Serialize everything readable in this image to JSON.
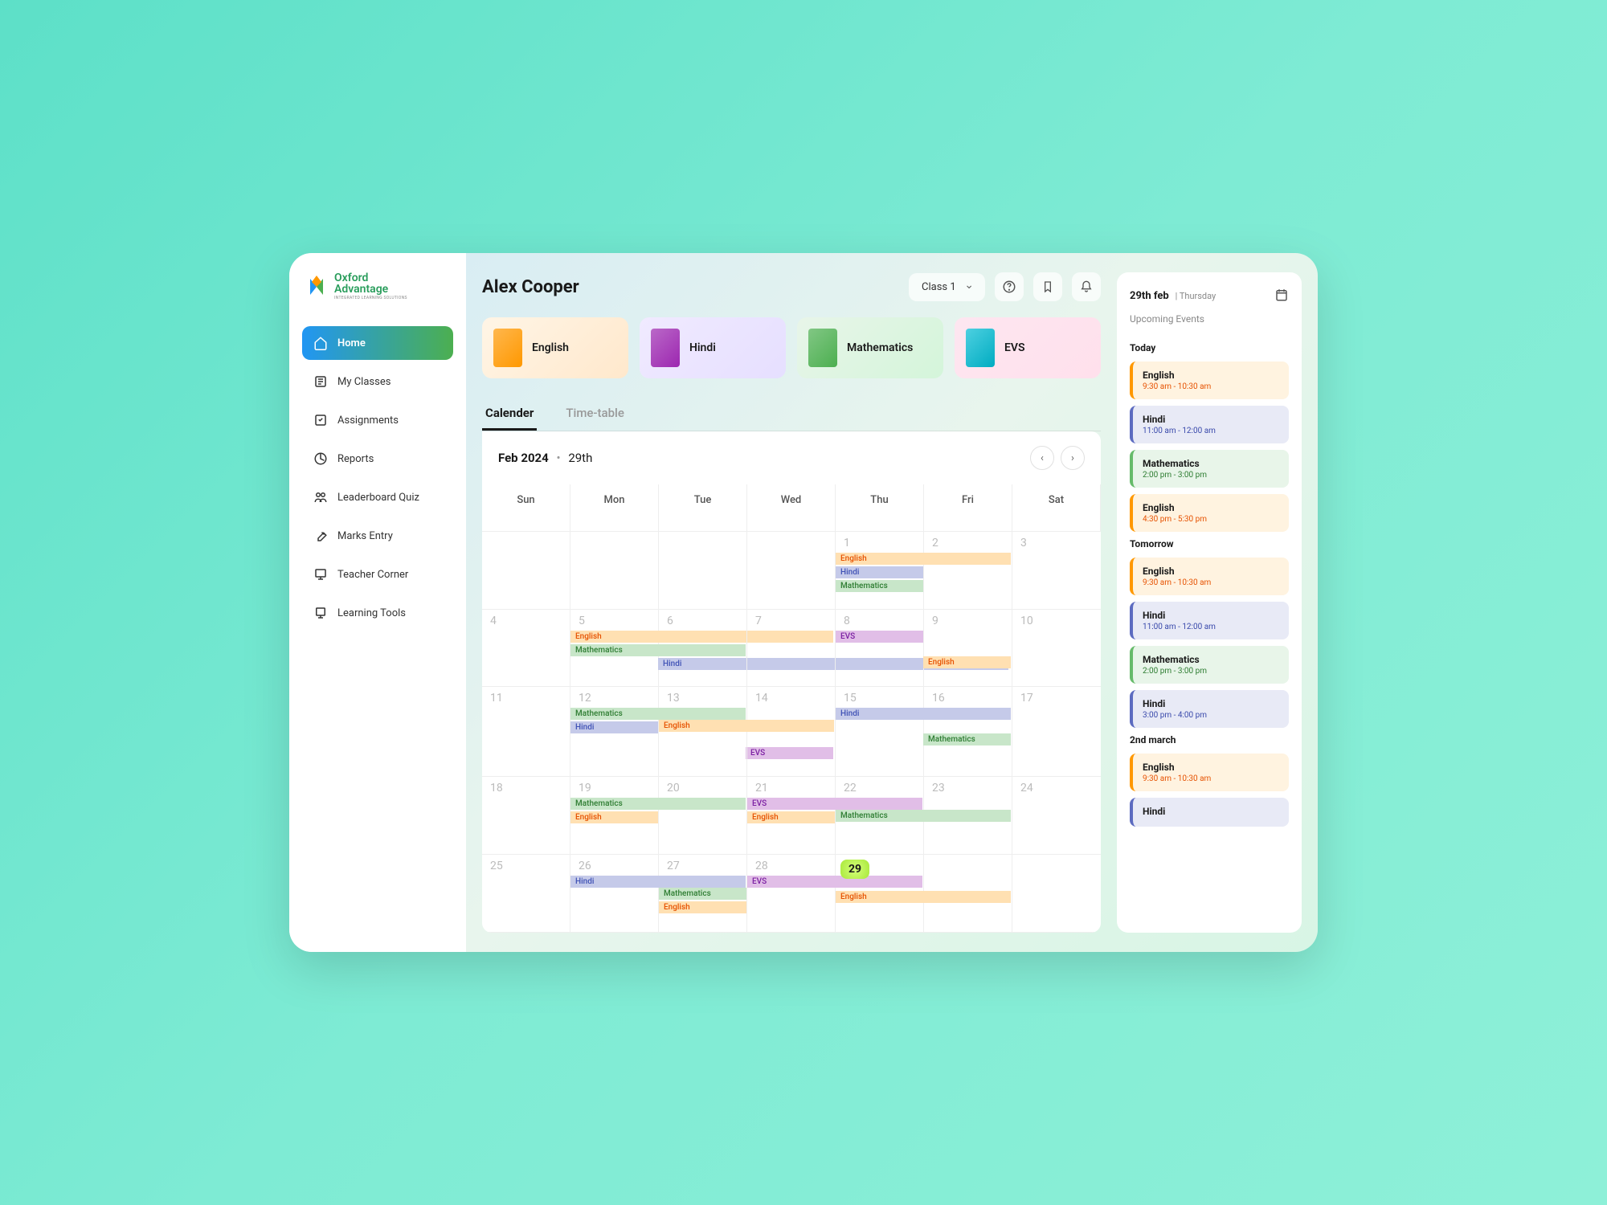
{
  "brand": {
    "line1": "Oxford",
    "line2": "Advantage",
    "tagline": "INTEGRATED LEARNING SOLUTIONS"
  },
  "nav": [
    {
      "label": "Home",
      "icon": "home",
      "active": true
    },
    {
      "label": "My Classes",
      "icon": "classes",
      "active": false
    },
    {
      "label": "Assignments",
      "icon": "assignments",
      "active": false
    },
    {
      "label": "Reports",
      "icon": "reports",
      "active": false
    },
    {
      "label": "Leaderboard Quiz",
      "icon": "leaderboard",
      "active": false
    },
    {
      "label": "Marks Entry",
      "icon": "marks",
      "active": false
    },
    {
      "label": "Teacher Corner",
      "icon": "teacher",
      "active": false
    },
    {
      "label": "Learning Tools",
      "icon": "tools",
      "active": false
    }
  ],
  "user": {
    "name": "Alex Cooper"
  },
  "classSelector": {
    "value": "Class 1",
    "options": [
      "Class 1"
    ]
  },
  "subjects": [
    {
      "name": "English",
      "key": "eng"
    },
    {
      "name": "Hindi",
      "key": "hin"
    },
    {
      "name": "Mathematics",
      "key": "mat"
    },
    {
      "name": "EVS",
      "key": "evs"
    }
  ],
  "tabs": [
    {
      "label": "Calender",
      "active": true
    },
    {
      "label": "Time-table",
      "active": false
    }
  ],
  "calendar": {
    "month": "Feb 2024",
    "day": "29th",
    "dayHeaders": [
      "Sun",
      "Mon",
      "Tue",
      "Wed",
      "Thu",
      "Fri",
      "Sat"
    ],
    "cells": [
      {
        "date": "",
        "events": []
      },
      {
        "date": "",
        "events": []
      },
      {
        "date": "",
        "events": []
      },
      {
        "date": "",
        "events": []
      },
      {
        "date": "1",
        "events": [
          {
            "label": "English",
            "cls": "english",
            "span": 2
          },
          {
            "label": "Hindi",
            "cls": "hindi",
            "span": 1
          },
          {
            "label": "Mathematics",
            "cls": "mathematics",
            "span": 1
          }
        ]
      },
      {
        "date": "2",
        "events": []
      },
      {
        "date": "3",
        "events": []
      },
      {
        "date": "4",
        "events": []
      },
      {
        "date": "5",
        "events": [
          {
            "label": "English",
            "cls": "english",
            "span": 3
          },
          {
            "label": "Mathematics",
            "cls": "mathematics",
            "span": 2
          },
          {
            "label": "Hindi",
            "cls": "hindi",
            "span": 4,
            "offset": 1
          }
        ]
      },
      {
        "date": "6",
        "events": []
      },
      {
        "date": "7",
        "events": []
      },
      {
        "date": "8",
        "events": [
          {
            "label": "EVS",
            "cls": "evs",
            "span": 1
          },
          {
            "label": "English",
            "cls": "english",
            "span": 1,
            "offset": 1,
            "skip": 1
          }
        ]
      },
      {
        "date": "9",
        "events": []
      },
      {
        "date": "10",
        "events": []
      },
      {
        "date": "11",
        "events": []
      },
      {
        "date": "12",
        "events": [
          {
            "label": "Mathematics",
            "cls": "mathematics",
            "span": 2
          },
          {
            "label": "Hindi",
            "cls": "hindi",
            "span": 1
          },
          {
            "label": "EVS",
            "cls": "evs",
            "span": 1,
            "offset": 2,
            "skip": 1
          }
        ]
      },
      {
        "date": "13",
        "events": [
          {
            "label": "English",
            "cls": "english",
            "span": 2,
            "skip": 1
          }
        ]
      },
      {
        "date": "14",
        "events": []
      },
      {
        "date": "15",
        "events": [
          {
            "label": "Hindi",
            "cls": "hindi",
            "span": 2
          },
          {
            "label": "Mathematics",
            "cls": "mathematics",
            "span": 1,
            "offset": 1,
            "skip": 1
          }
        ]
      },
      {
        "date": "16",
        "events": []
      },
      {
        "date": "17",
        "events": []
      },
      {
        "date": "18",
        "events": []
      },
      {
        "date": "19",
        "events": [
          {
            "label": "Mathematics",
            "cls": "mathematics",
            "span": 2
          },
          {
            "label": "English",
            "cls": "english",
            "span": 1
          }
        ]
      },
      {
        "date": "20",
        "events": []
      },
      {
        "date": "21",
        "events": [
          {
            "label": "EVS",
            "cls": "evs",
            "span": 2
          },
          {
            "label": "English",
            "cls": "english",
            "span": 1
          }
        ]
      },
      {
        "date": "22",
        "events": [
          {
            "label": "Mathematics",
            "cls": "mathematics",
            "span": 2,
            "skip": 1
          }
        ]
      },
      {
        "date": "23",
        "events": []
      },
      {
        "date": "24",
        "events": []
      },
      {
        "date": "25",
        "events": []
      },
      {
        "date": "26",
        "events": [
          {
            "label": "Hindi",
            "cls": "hindi",
            "span": 2
          }
        ]
      },
      {
        "date": "27",
        "events": [
          {
            "label": "Mathematics",
            "cls": "mathematics",
            "span": 1,
            "skip": 1
          },
          {
            "label": "English",
            "cls": "english",
            "span": 1
          }
        ]
      },
      {
        "date": "28",
        "events": [
          {
            "label": "EVS",
            "cls": "evs",
            "span": 2
          }
        ]
      },
      {
        "date": "29",
        "today": true,
        "events": [
          {
            "label": "English",
            "cls": "english",
            "span": 2,
            "skip": 1
          }
        ]
      },
      {
        "date": "",
        "events": []
      },
      {
        "date": "",
        "events": []
      }
    ]
  },
  "rightPanel": {
    "date": "29th feb",
    "dayName": "Thursday",
    "subtitle": "Upcoming Events",
    "sections": [
      {
        "label": "Today",
        "events": [
          {
            "name": "English",
            "time": "9:30 am - 10:30 am",
            "cls": "english"
          },
          {
            "name": "Hindi",
            "time": "11:00 am - 12:00 am",
            "cls": "hindi"
          },
          {
            "name": "Mathematics",
            "time": "2:00 pm - 3:00 pm",
            "cls": "mathematics"
          },
          {
            "name": "English",
            "time": "4:30 pm - 5:30 pm",
            "cls": "english"
          }
        ]
      },
      {
        "label": "Tomorrow",
        "events": [
          {
            "name": "English",
            "time": "9:30 am - 10:30 am",
            "cls": "english"
          },
          {
            "name": "Hindi",
            "time": "11:00 am - 12:00 am",
            "cls": "hindi"
          },
          {
            "name": "Mathematics",
            "time": "2:00 pm - 3:00 pm",
            "cls": "mathematics"
          },
          {
            "name": "Hindi",
            "time": "3:00 pm - 4:00 pm",
            "cls": "hindi"
          }
        ]
      },
      {
        "label": "2nd march",
        "events": [
          {
            "name": "English",
            "time": "9:30 am - 10:30 am",
            "cls": "english"
          },
          {
            "name": "Hindi",
            "time": "",
            "cls": "hindi"
          }
        ]
      }
    ]
  }
}
